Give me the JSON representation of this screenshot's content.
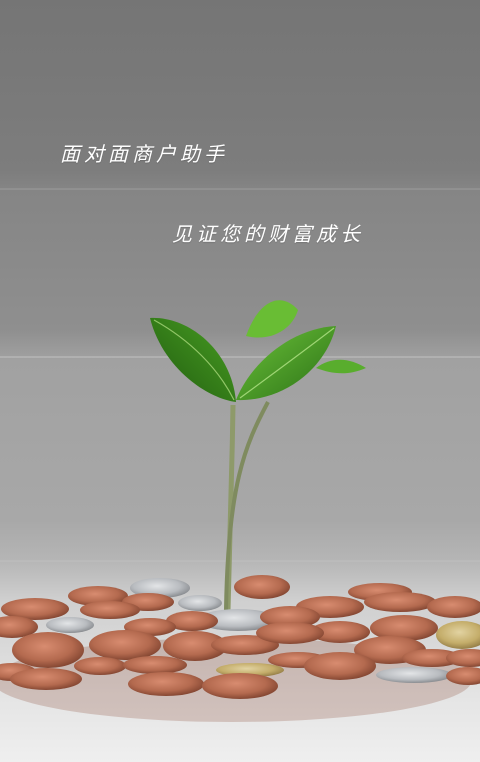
{
  "splash": {
    "headline_primary": "面对面商户助手",
    "headline_secondary": "见证您的财富成长"
  },
  "colors": {
    "text": "#ffffff",
    "leaf_dark": "#2f7a17",
    "leaf_light": "#5aa42a",
    "coin_copper": "#b46a4f",
    "coin_silver": "#b9bcc0",
    "coin_gold": "#c4ad6a"
  },
  "icons": {
    "illustration": "seedling-growing-from-coins"
  }
}
